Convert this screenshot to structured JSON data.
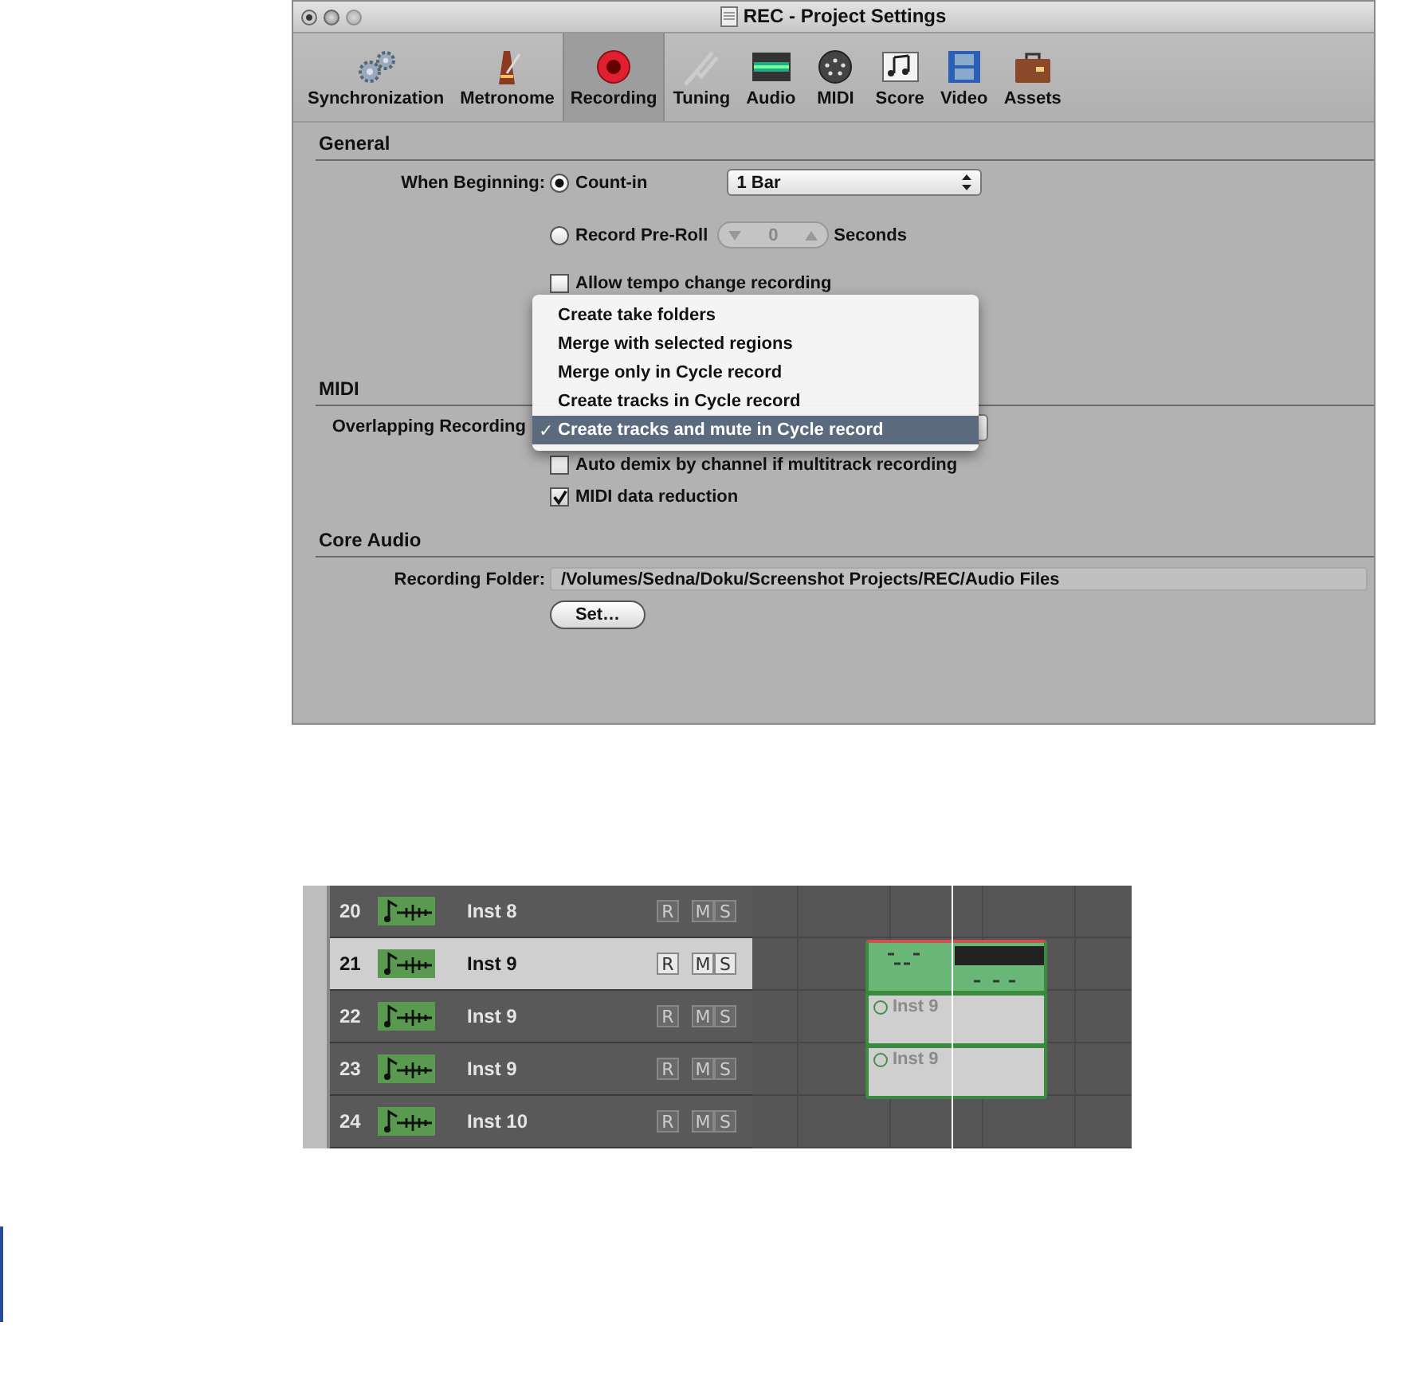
{
  "window": {
    "title": "REC - Project Settings",
    "tabs": [
      {
        "label": "Synchronization",
        "selected": false
      },
      {
        "label": "Metronome",
        "selected": false
      },
      {
        "label": "Recording",
        "selected": true
      },
      {
        "label": "Tuning",
        "selected": false
      },
      {
        "label": "Audio",
        "selected": false
      },
      {
        "label": "MIDI",
        "selected": false
      },
      {
        "label": "Score",
        "selected": false
      },
      {
        "label": "Video",
        "selected": false
      },
      {
        "label": "Assets",
        "selected": false
      }
    ]
  },
  "general": {
    "heading": "General",
    "when_beginning_label": "When Beginning:",
    "options": [
      {
        "kind": "popup",
        "label": "Count-in",
        "selected": true,
        "value": "1 Bar"
      },
      {
        "kind": "stepper",
        "label": "Record Pre-Roll",
        "selected": false,
        "value": "0",
        "unit": "Seconds"
      }
    ],
    "checkboxes": [
      {
        "label": "Allow tempo change recording",
        "checked": false
      }
    ]
  },
  "midi": {
    "heading": "MIDI",
    "overlapping_label": "Overlapping Recording",
    "menu": [
      {
        "label": "Create take folders",
        "selected": false
      },
      {
        "label": "Merge with selected regions",
        "selected": false
      },
      {
        "label": "Merge only in Cycle record",
        "selected": false
      },
      {
        "label": "Create tracks in Cycle record",
        "selected": false
      },
      {
        "label": "Create tracks and mute in Cycle record",
        "selected": true
      }
    ],
    "check_mark": "✓",
    "checkboxes": [
      {
        "label": "Auto demix by channel if multitrack recording",
        "checked": false
      },
      {
        "label": "MIDI data reduction",
        "checked": true
      }
    ]
  },
  "core_audio": {
    "heading": "Core Audio",
    "folder_label": "Recording Folder:",
    "folder_path": "/Volumes/Sedna/Doku/Screenshot Projects/REC/Audio Files",
    "set_button": "Set…"
  },
  "tracks": [
    {
      "number": "20",
      "name": "Inst 8",
      "selected": false,
      "buttons": [
        "R",
        "M",
        "S"
      ]
    },
    {
      "number": "21",
      "name": "Inst 9",
      "selected": true,
      "buttons": [
        "R",
        "M",
        "S"
      ],
      "region": {
        "kind": "recording"
      }
    },
    {
      "number": "22",
      "name": "Inst 9",
      "selected": false,
      "buttons": [
        "R",
        "M",
        "S"
      ],
      "region": {
        "kind": "muted",
        "label": "Inst 9"
      }
    },
    {
      "number": "23",
      "name": "Inst 9",
      "selected": false,
      "buttons": [
        "R",
        "M",
        "S"
      ],
      "region": {
        "kind": "muted",
        "label": "Inst 9"
      }
    },
    {
      "number": "24",
      "name": "Inst 10",
      "selected": false,
      "buttons": [
        "R",
        "M",
        "S"
      ]
    }
  ]
}
